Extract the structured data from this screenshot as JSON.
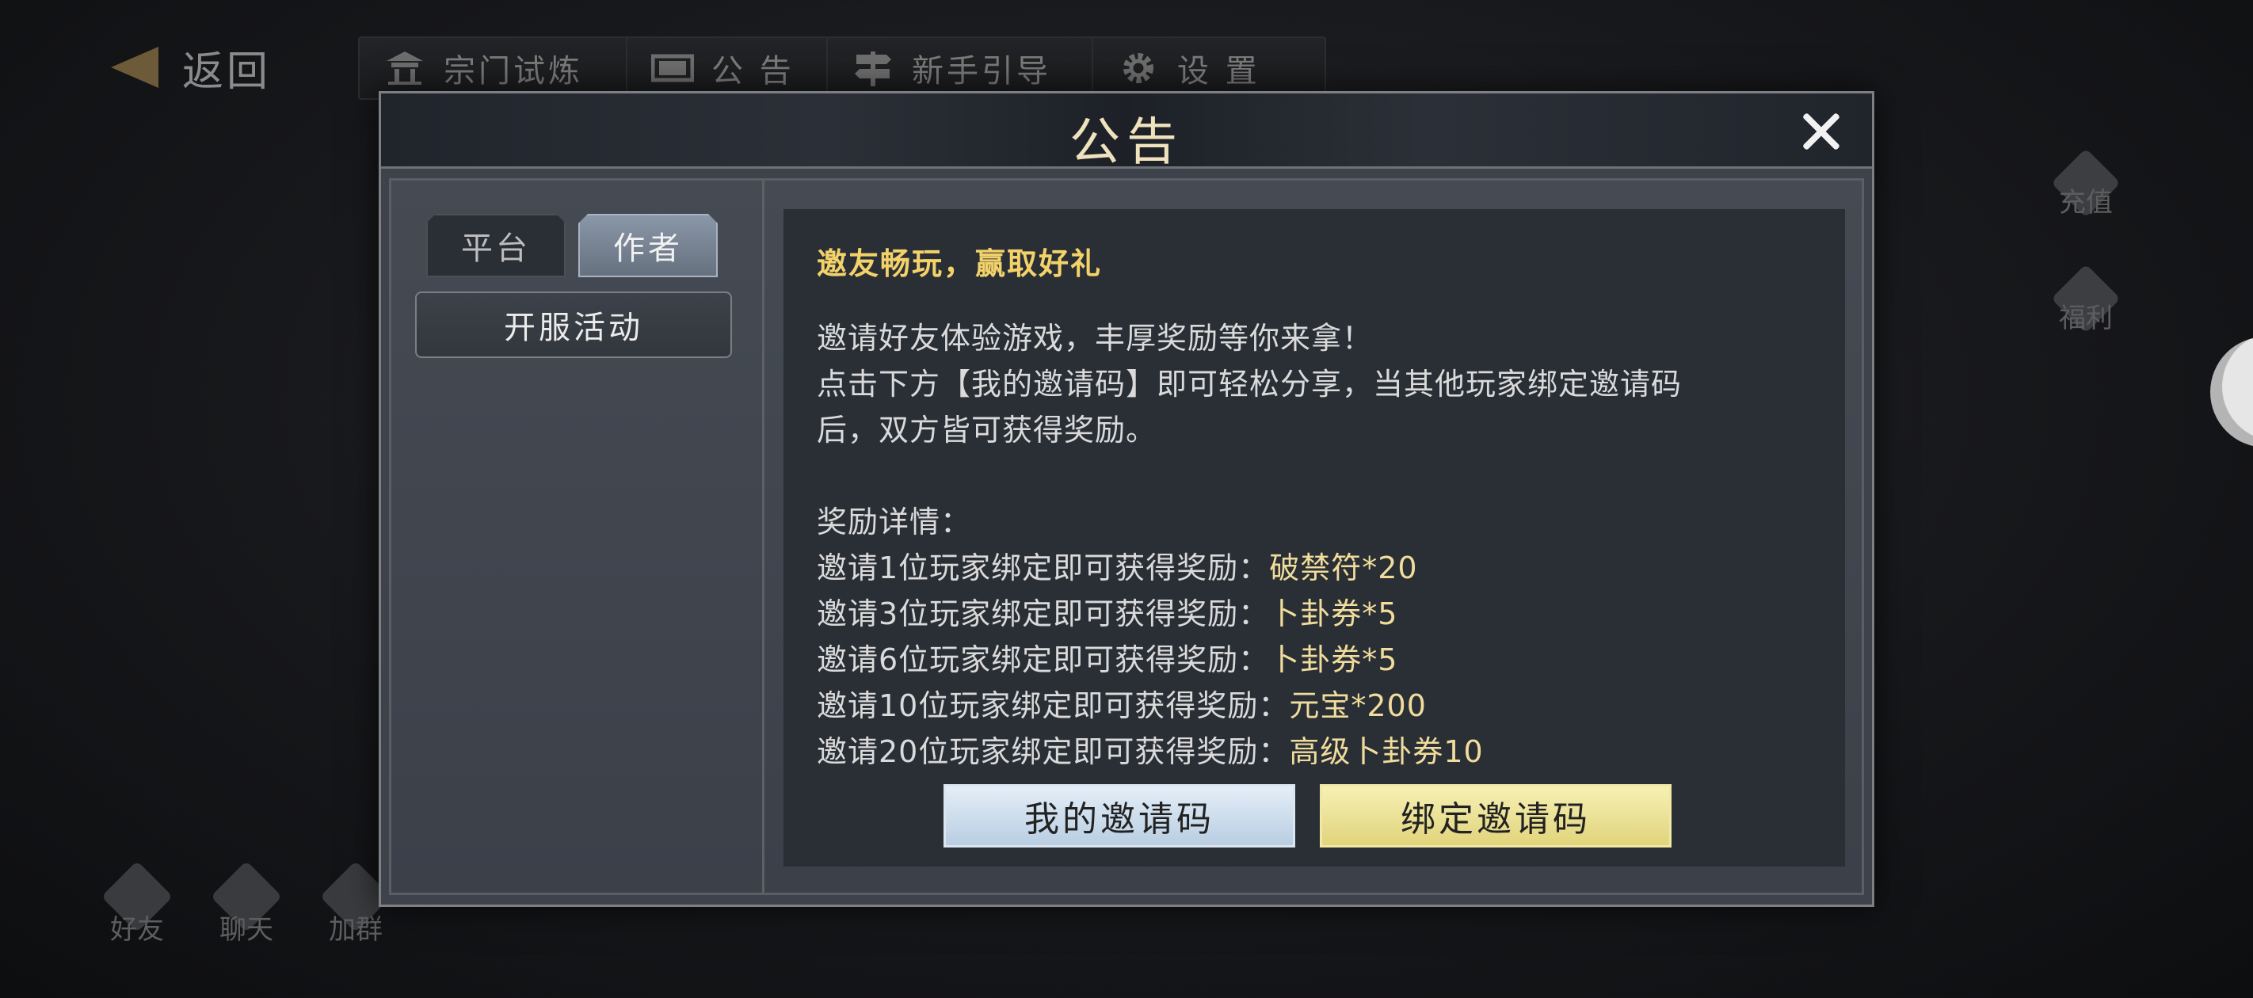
{
  "topbar": {
    "back_label": "返回",
    "buttons": [
      {
        "label": "宗门试炼",
        "icon": "gate-icon"
      },
      {
        "label": "公 告",
        "icon": "scroll-icon"
      },
      {
        "label": "新手引导",
        "icon": "signpost-icon"
      },
      {
        "label": "设 置",
        "icon": "gear-icon"
      }
    ]
  },
  "side": {
    "recharge_label": "充值",
    "welfare_label": "福利"
  },
  "bottom": {
    "friends_label": "好友",
    "chat_label": "聊天",
    "group_label": "加群"
  },
  "dialog": {
    "title": "公告",
    "tabs": [
      {
        "label": "平台",
        "active": false
      },
      {
        "label": "作者",
        "active": true
      }
    ],
    "category": "开服活动",
    "content": {
      "heading": "邀友畅玩，赢取好礼",
      "intro": [
        "邀请好友体验游戏，丰厚奖励等你来拿！",
        "点击下方【我的邀请码】即可轻松分享，当其他玩家绑定邀请码",
        "后，双方皆可获得奖励。"
      ],
      "rewards_title": "奖励详情：",
      "rewards": [
        {
          "text": "邀请1位玩家绑定即可获得奖励：",
          "reward": "破禁符*20"
        },
        {
          "text": "邀请3位玩家绑定即可获得奖励：",
          "reward": "卜卦券*5"
        },
        {
          "text": "邀请6位玩家绑定即可获得奖励：",
          "reward": "卜卦券*5"
        },
        {
          "text": "邀请10位玩家绑定即可获得奖励：",
          "reward": "元宝*200"
        },
        {
          "text": "邀请20位玩家绑定即可获得奖励：",
          "reward": "高级卜卦券10"
        }
      ]
    },
    "buttons": {
      "my_code": "我的邀请码",
      "bind_code": "绑定邀请码"
    }
  },
  "colors": {
    "accent_gold": "#f4d26a",
    "title_cream": "#efe2bd",
    "reward_text": "#f0dc9c"
  }
}
